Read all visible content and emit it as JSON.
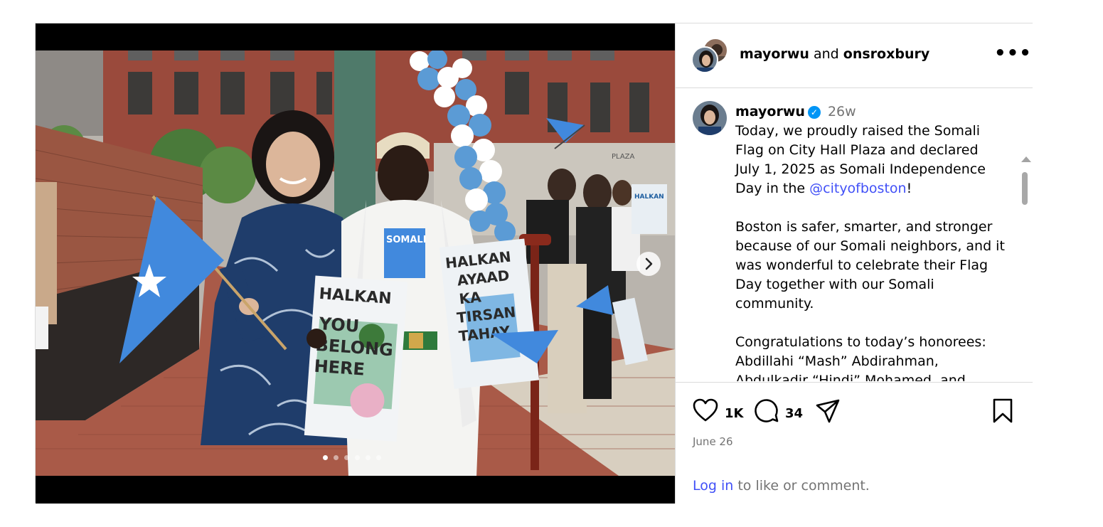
{
  "post": {
    "header": {
      "user1": "mayorwu",
      "joiner": "and",
      "user2": "onsroxbury",
      "more_label": "•••"
    },
    "caption": {
      "username": "mayorwu",
      "verified_icon": "✓",
      "time": "26w",
      "p1_before": "Today, we proudly raised the Somali Flag on City Hall Plaza and declared July 1, 2025 as Somali Independence Day in the ",
      "p1_mention": "@cityofboston",
      "p1_after": "!",
      "p2": "Boston is safer, smarter, and stronger because of our Somali neighbors, and it was wonderful to celebrate their Flag Day together with our Somali community.",
      "p3": "Congratulations to today’s honorees: Abdillahi “Mash” Abdirahman, Abdulkadir “Hindi” Mohamed, and"
    },
    "actions": {
      "likes": "1K",
      "comments": "34",
      "date": "June 26",
      "login_link": "Log in",
      "login_rest": " to like or comment."
    },
    "photo": {
      "sign_left_line1": "HALKAN",
      "sign_left_line2": "YOU",
      "sign_left_line3": "BELONG",
      "sign_left_line4": "HERE",
      "sign_right_line1": "HALKAN",
      "sign_right_line2": "AYAAD",
      "sign_right_line3": "KA",
      "sign_right_line4": "TIRSAN",
      "sign_right_line5": "TAHAY",
      "lanyard_text": "SOMALI",
      "building_text": "PLAZA"
    },
    "carousel": {
      "slides": 6,
      "active": 0
    },
    "colors": {
      "somali_blue": "#4189dd",
      "link_blue": "#4150f7",
      "verified_blue": "#0095f6",
      "brick": "#8b3a2e",
      "muted": "#737373"
    },
    "icons": [
      "heart-icon",
      "comment-icon",
      "share-icon",
      "bookmark-icon",
      "chevron-right-icon",
      "more-icon"
    ]
  }
}
